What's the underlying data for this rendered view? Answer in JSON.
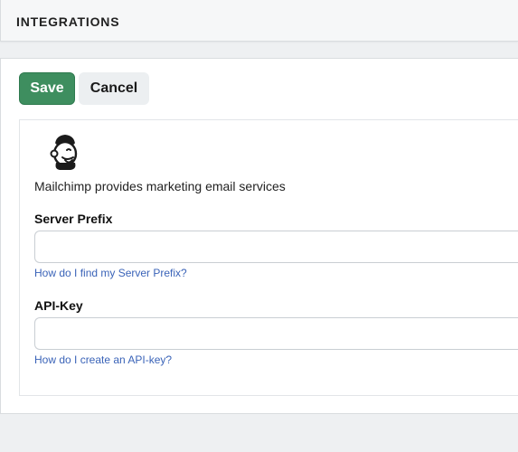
{
  "header": {
    "title": "INTEGRATIONS"
  },
  "actions": {
    "save_label": "Save",
    "cancel_label": "Cancel"
  },
  "integration": {
    "logo_icon": "mailchimp-freddie-icon",
    "description": "Mailchimp provides marketing email services",
    "fields": [
      {
        "label": "Server Prefix",
        "value": "",
        "placeholder": "",
        "help_link": "How do I find my Server Prefix?"
      },
      {
        "label": "API-Key",
        "value": "",
        "placeholder": "",
        "help_link": "How do I create an API-key?"
      }
    ]
  },
  "colors": {
    "save_button": "#3e8e5f",
    "cancel_button": "#eceff1",
    "link": "#3a63b8",
    "page_background": "#eef0f2"
  }
}
